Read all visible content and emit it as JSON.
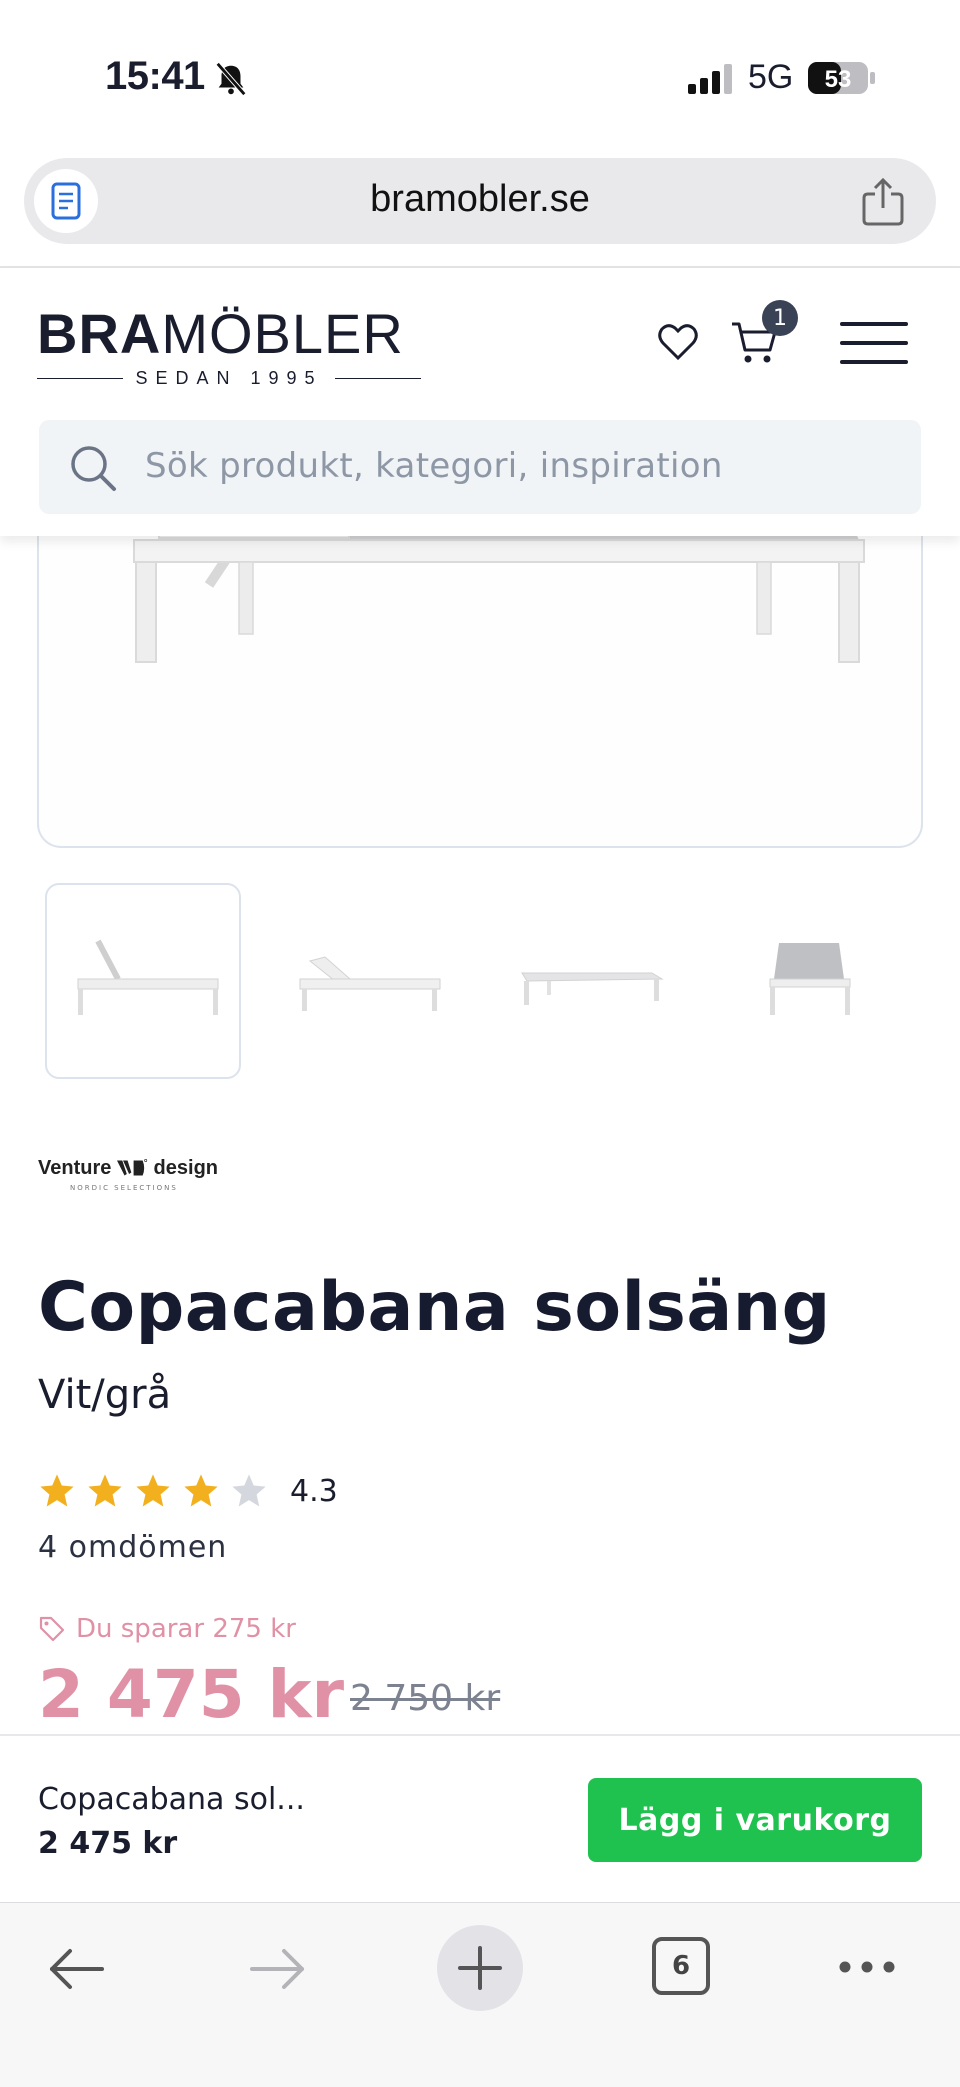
{
  "status_bar": {
    "time": "15:41",
    "network": "5G",
    "battery": "53"
  },
  "browser": {
    "url": "bramobler.se",
    "tab_count": "6"
  },
  "header": {
    "logo_bold": "BRA",
    "logo_light": "MÖBLER",
    "logo_tagline": "SEDAN 1995",
    "cart_count": "1",
    "search_placeholder": "Sök produkt, kategori, inspiration"
  },
  "product": {
    "brand_name_left": "Venture",
    "brand_name_right": "design",
    "brand_tagline": "NORDIC SELECTIONS",
    "title": "Copacabana solsäng",
    "variant": "Vit/grå",
    "rating": 4.3,
    "rating_label": "4.3",
    "reviews": "4 omdömen",
    "savings": "Du sparar 275 kr",
    "price": "2 475 kr",
    "old_price": "2 750 kr",
    "thumbnail_count": 4
  },
  "sticky_bar": {
    "name": "Copacabana sol...",
    "price": "2 475 kr",
    "add_button": "Lägg i varukorg"
  },
  "colors": {
    "accent_pink": "#e191a6",
    "buy_green": "#1fc14f",
    "text_dark": "#161b30",
    "star_gold": "#f2b01e"
  }
}
